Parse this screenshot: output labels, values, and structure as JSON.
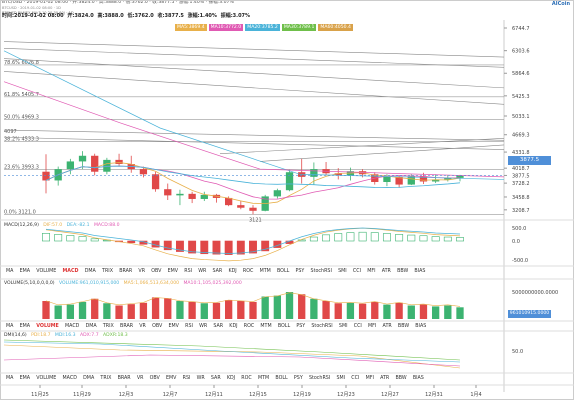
{
  "header": {
    "info": "BTC/USD · 2019-01-02 08:00 · 开:3824.0 · 高:3888.0 · 低:3762.0 · 收:3877.5 · 涨幅:1.40% · 振幅:3.07%",
    "sub1": "BTCUSD · 2019-01-02 08:00 · 1D",
    "sub2": "BTCUSD BitMEX MA(5,10,20,30,60) · 1D",
    "ohlc": [
      "时间:2019-01-02 08:00",
      "开:3824.0",
      "高:3888.0",
      "低:3762.0",
      "收:3877.5",
      "涨幅:1.40%",
      "振幅:3.07%"
    ],
    "ma_items": [
      {
        "label": "MA5:3869.4",
        "color": "#e8b04a"
      },
      {
        "label": "MA10:3772.0",
        "color": "#e05ab3"
      },
      {
        "label": "MA20:3785.2",
        "color": "#4ab3d9"
      },
      {
        "label": "MA30:3789.1",
        "color": "#6fbf4a"
      },
      {
        "label": "MA60:4050.4",
        "color": "#d9a24a"
      }
    ],
    "logo": "AICoin"
  },
  "price_axis": [
    "6744.7",
    "6303.6",
    "5864.6",
    "5425.3",
    "5033.1",
    "4669.3",
    "4331.8",
    "4018.7",
    "3877.5",
    "3728.2",
    "3458.8",
    "3208.7"
  ],
  "last_price": "3877.5",
  "fib_levels": [
    "78.6% 6026.8",
    "61.8% 5405.7",
    "50.0% 4969.3",
    "38.2% 4533.3",
    "23.6% 3993.3",
    "0.0% 3121.0"
  ],
  "low_marker": "3121",
  "label_4097": "4097",
  "macd": {
    "title": "MACD(12,26,9)",
    "dif": "DIF:57.0",
    "dea": "DEA:-82.1",
    "macd": "MACD:88.0",
    "axis": [
      "500.0",
      "0.0",
      "-500.0"
    ]
  },
  "tabs_row1": [
    "MA",
    "EMA",
    "VOLUME",
    "MACD",
    "DMA",
    "TRIX",
    "BRAR",
    "VR",
    "OBV",
    "EMV",
    "RSI",
    "WR",
    "SAR",
    "KDJ",
    "ROC",
    "MTM",
    "BOLL",
    "PSY",
    "StochRSI",
    "SMI",
    "CCI",
    "MFI",
    "ATR",
    "BBW",
    "BIAS"
  ],
  "tabs_row1_active": "MACD",
  "vol": {
    "title": "VOLUME(5,10,0,0,0,0)",
    "vol": "VOLUME:961,010,915,000",
    "ma5": "MA5:1,066,513,634,000",
    "ma10": "MA10:1,105,025,392,000",
    "axis": [
      "5000000000.0000"
    ],
    "tag": "961010915.0000"
  },
  "tabs_row2": [
    "MA",
    "EMA",
    "VOLUME",
    "MACD",
    "DMA",
    "TRIX",
    "BRAR",
    "VR",
    "OBV",
    "EMV",
    "RSI",
    "WR",
    "SAR",
    "KDJ",
    "ROC",
    "MTM",
    "BOLL",
    "PSY",
    "StochRSI",
    "SMI",
    "CCI",
    "MFI",
    "ATR",
    "BBW",
    "BIAS"
  ],
  "tabs_row2_active": "VOLUME",
  "dmi": {
    "title": "DMI(14,6)",
    "pdi": "PDI:18.7",
    "mdi": "MDI:16.3",
    "adx": "ADX:7.7",
    "adxr": "ADXR:18.3",
    "axis": [
      "50.0"
    ]
  },
  "tabs_row3": [
    "MA",
    "EMA",
    "VOLUME",
    "MACD",
    "DMA",
    "TRIX",
    "BRAR",
    "VR",
    "OBV",
    "EMV",
    "RSI",
    "WR",
    "SAR",
    "KDJ",
    "ROC",
    "MTM",
    "BOLL",
    "PSY",
    "StochRSI",
    "SMI",
    "CCI",
    "MFI",
    "ATR",
    "BBW",
    "BIAS"
  ],
  "tabs_row3_active": "DMI",
  "date_axis": [
    "11月25",
    "11月29",
    "12月3",
    "12月7",
    "12月11",
    "12月15",
    "12月19",
    "12月23",
    "12月27",
    "12月31",
    "1月4"
  ],
  "colors": {
    "up": "#3cb371",
    "down": "#e04848",
    "accent": "#4f8fd8"
  },
  "candles": [
    {
      "o": 3950,
      "h": 4290,
      "l": 3530,
      "c": 3780
    },
    {
      "o": 3780,
      "h": 4050,
      "l": 3680,
      "c": 4000
    },
    {
      "o": 4000,
      "h": 4200,
      "l": 3900,
      "c": 4150
    },
    {
      "o": 4150,
      "h": 4350,
      "l": 4000,
      "c": 4260
    },
    {
      "o": 4260,
      "h": 4300,
      "l": 3880,
      "c": 3950
    },
    {
      "o": 3950,
      "h": 4220,
      "l": 3900,
      "c": 4180
    },
    {
      "o": 4180,
      "h": 4300,
      "l": 4050,
      "c": 4100
    },
    {
      "o": 4100,
      "h": 4260,
      "l": 3930,
      "c": 4000
    },
    {
      "o": 4000,
      "h": 4050,
      "l": 3840,
      "c": 3900
    },
    {
      "o": 3900,
      "h": 3950,
      "l": 3560,
      "c": 3610
    },
    {
      "o": 3610,
      "h": 3720,
      "l": 3400,
      "c": 3490
    },
    {
      "o": 3490,
      "h": 3600,
      "l": 3300,
      "c": 3520
    },
    {
      "o": 3520,
      "h": 3560,
      "l": 3340,
      "c": 3420
    },
    {
      "o": 3420,
      "h": 3560,
      "l": 3380,
      "c": 3500
    },
    {
      "o": 3500,
      "h": 3520,
      "l": 3350,
      "c": 3440
    },
    {
      "o": 3440,
      "h": 3470,
      "l": 3280,
      "c": 3300
    },
    {
      "o": 3300,
      "h": 3380,
      "l": 3220,
      "c": 3250
    },
    {
      "o": 3250,
      "h": 3300,
      "l": 3121,
      "c": 3190
    },
    {
      "o": 3190,
      "h": 3500,
      "l": 3180,
      "c": 3470
    },
    {
      "o": 3470,
      "h": 3620,
      "l": 3430,
      "c": 3590
    },
    {
      "o": 3590,
      "h": 3990,
      "l": 3570,
      "c": 3940
    },
    {
      "o": 3940,
      "h": 4200,
      "l": 3720,
      "c": 3850
    },
    {
      "o": 3850,
      "h": 4130,
      "l": 3700,
      "c": 4000
    },
    {
      "o": 4000,
      "h": 4140,
      "l": 3880,
      "c": 3920
    },
    {
      "o": 3920,
      "h": 4020,
      "l": 3800,
      "c": 3880
    },
    {
      "o": 3880,
      "h": 4030,
      "l": 3780,
      "c": 3960
    },
    {
      "o": 3960,
      "h": 4000,
      "l": 3840,
      "c": 3900
    },
    {
      "o": 3900,
      "h": 3940,
      "l": 3700,
      "c": 3750
    },
    {
      "o": 3750,
      "h": 3900,
      "l": 3670,
      "c": 3850
    },
    {
      "o": 3850,
      "h": 3880,
      "l": 3640,
      "c": 3700
    },
    {
      "o": 3700,
      "h": 3900,
      "l": 3690,
      "c": 3860
    },
    {
      "o": 3860,
      "h": 3930,
      "l": 3710,
      "c": 3760
    },
    {
      "o": 3760,
      "h": 3900,
      "l": 3730,
      "c": 3800
    },
    {
      "o": 3800,
      "h": 3880,
      "l": 3760,
      "c": 3830
    },
    {
      "o": 3830,
      "h": 3888,
      "l": 3762,
      "c": 3877.5
    }
  ],
  "volumes": [
    40,
    30,
    32,
    38,
    45,
    35,
    30,
    33,
    36,
    48,
    46,
    40,
    38,
    35,
    36,
    42,
    40,
    38,
    50,
    52,
    60,
    55,
    45,
    40,
    35,
    36,
    34,
    38,
    32,
    36,
    30,
    32,
    28,
    30,
    26
  ],
  "macd_bars": [
    35,
    30,
    25,
    20,
    10,
    4,
    -2,
    -8,
    -15,
    -28,
    -40,
    -48,
    -55,
    -58,
    -60,
    -62,
    -60,
    -55,
    -45,
    -30,
    -12,
    5,
    18,
    28,
    34,
    38,
    40,
    38,
    34,
    30,
    27,
    24,
    20,
    18,
    16
  ]
}
